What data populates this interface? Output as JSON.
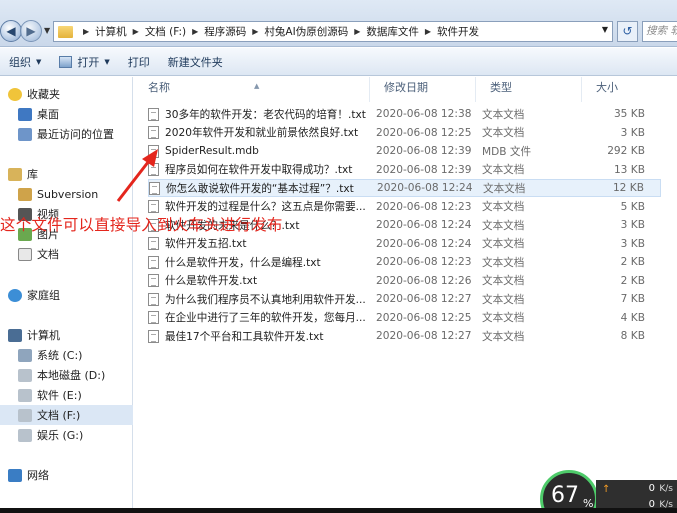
{
  "address": {
    "crumbs": [
      "计算机",
      "文档 (F:)",
      "程序源码",
      "村兔AI伪原创源码",
      "数据库文件",
      "软件开发"
    ],
    "search_placeholder": "搜索 软件开发"
  },
  "toolbar": {
    "organize": "组织",
    "open": "打开",
    "print": "打印",
    "new_folder": "新建文件夹"
  },
  "nav": {
    "favorites": "收藏夹",
    "desktop": "桌面",
    "recent": "最近访问的位置",
    "libraries": "库",
    "subversion": "Subversion",
    "video": "视频",
    "pictures": "图片",
    "documents": "文档",
    "homegroup": "家庭组",
    "computer": "计算机",
    "drive_c": "系统 (C:)",
    "drive_d": "本地磁盘 (D:)",
    "drive_e": "软件 (E:)",
    "drive_f": "文档 (F:)",
    "drive_g": "娱乐 (G:)",
    "network": "网络"
  },
  "columns": {
    "name": "名称",
    "date": "修改日期",
    "type": "类型",
    "size": "大小"
  },
  "files": [
    {
      "name": "30多年的软件开发：老农代码的培育！.txt",
      "date": "2020-06-08 12:38",
      "type": "文本文档",
      "size": "35 KB"
    },
    {
      "name": "2020年软件开发和就业前景依然良好.txt",
      "date": "2020-06-08 12:25",
      "type": "文本文档",
      "size": "3 KB"
    },
    {
      "name": "SpiderResult.mdb",
      "date": "2020-06-08 12:39",
      "type": "MDB 文件",
      "size": "292 KB"
    },
    {
      "name": "程序员如何在软件开发中取得成功？.txt",
      "date": "2020-06-08 12:39",
      "type": "文本文档",
      "size": "13 KB"
    },
    {
      "name": "你怎么敢说软件开发的“基本过程”？.txt",
      "date": "2020-06-08 12:24",
      "type": "文本文档",
      "size": "12 KB"
    },
    {
      "name": "软件开发的过程是什么？这五点是你需要...",
      "date": "2020-06-08 12:23",
      "type": "文本文档",
      "size": "5 KB"
    },
    {
      "name": "软件开发的未来是什么？.txt",
      "date": "2020-06-08 12:24",
      "type": "文本文档",
      "size": "3 KB"
    },
    {
      "name": "软件开发五招.txt",
      "date": "2020-06-08 12:24",
      "type": "文本文档",
      "size": "3 KB"
    },
    {
      "name": "什么是软件开发，什么是编程.txt",
      "date": "2020-06-08 12:23",
      "type": "文本文档",
      "size": "2 KB"
    },
    {
      "name": "什么是软件开发.txt",
      "date": "2020-06-08 12:26",
      "type": "文本文档",
      "size": "2 KB"
    },
    {
      "name": "为什么我们程序员不认真地利用软件开发...",
      "date": "2020-06-08 12:27",
      "type": "文本文档",
      "size": "7 KB"
    },
    {
      "name": "在企业中进行了三年的软件开发，您每月...",
      "date": "2020-06-08 12:25",
      "type": "文本文档",
      "size": "4 KB"
    },
    {
      "name": "最佳17个平台和工具软件开发.txt",
      "date": "2020-06-08 12:27",
      "type": "文本文档",
      "size": "8 KB"
    }
  ],
  "annotation": {
    "text": "这个文件可以直接导入到火车头进行发布",
    "color": "#e4261d"
  },
  "net": {
    "percent": "67",
    "percent_unit": "%",
    "up": "0",
    "down": "0",
    "unit": "K/s"
  }
}
